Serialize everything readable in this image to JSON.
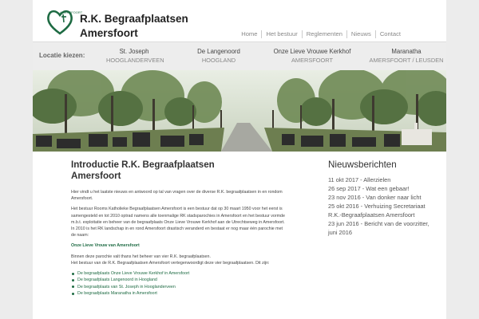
{
  "site": {
    "title_line1": "R.K. Begraafplaatsen",
    "title_line2": "Amersfoort",
    "logo_small": "AMERSFOORT"
  },
  "topnav": [
    "Home",
    "Het bestuur",
    "Reglementen",
    "Nieuws",
    "Contact"
  ],
  "location_bar": {
    "label": "Locatie kiezen:",
    "locations": [
      {
        "name": "St. Joseph",
        "place": "Hooglanderveen"
      },
      {
        "name": "De Langenoord",
        "place": "Hoogland"
      },
      {
        "name": "Onze Lieve Vrouwe Kerkhof",
        "place": "Amersfoort"
      },
      {
        "name": "Maranatha",
        "place": "Amersfoort / Leusden"
      }
    ]
  },
  "main": {
    "title_line1": "Introductie R.K. Begraafplaatsen",
    "title_line2": "Amersfoort",
    "p1": "Hier vindt u het laatste nieuws en antwoord op tal van vragen over de diverse R.K. begraafplaatsen in en rondom Amersfoort.",
    "p2": "Het bestuur Rooms Katholieke Begraafplaatsen Amersfoort is een bestuur dat op 30 maart 1950 voor het eerst is samengesteld en tot 2010 optrad namens alle toenmalige RK stadsparochies in Amersfoort en het bestuur vormde m.b.t. exploitatie en beheer van de begraafplaats Onze Lieve Vrouwe Kerkhof aan de Utrechtseweg in Amersfoort.",
    "p3": "In 2010 is het RK landschap in en rond Amersfoort drastisch veranderd en bestaat er nog maar één parochie met de naam:",
    "parish_link": "Onze Lieve Vrouw van Amersfoort",
    "p4": "Binnen deze parochie valt thans het beheer van vier R.K. begraafplaatsen.",
    "p5": "Het bestuur van de R.K. Begraafplaatsen Amersfoort vertegenwoordigt deze vier begraafplaatsen. Dit zijn:",
    "links": [
      "De begraafplaats Onze Lieve Vrouwe Kerkhof in Amersfoort",
      "De begraafplaats Langenoord in Hoogland",
      "De begraafplaats van St. Joseph in Hooglanderveen",
      "De begraafplaats Maranatha in Amersfoort"
    ]
  },
  "news": {
    "heading": "Nieuwsberichten",
    "items": [
      "11 okt 2017 - Allerzielen",
      "26 sep 2017 - Wat een gebaar!",
      "23 nov 2016 - Van donker naar licht",
      "25 okt 2016 - Verhuizing Secretariaat R.K.-Begraafplaatsen Amersfoort",
      "23 jun 2016 - Bericht van de voorzitter, juni 2016"
    ]
  },
  "colors": {
    "accent": "#1e6b43",
    "background": "#ececec",
    "location_bar": "#ededed"
  }
}
